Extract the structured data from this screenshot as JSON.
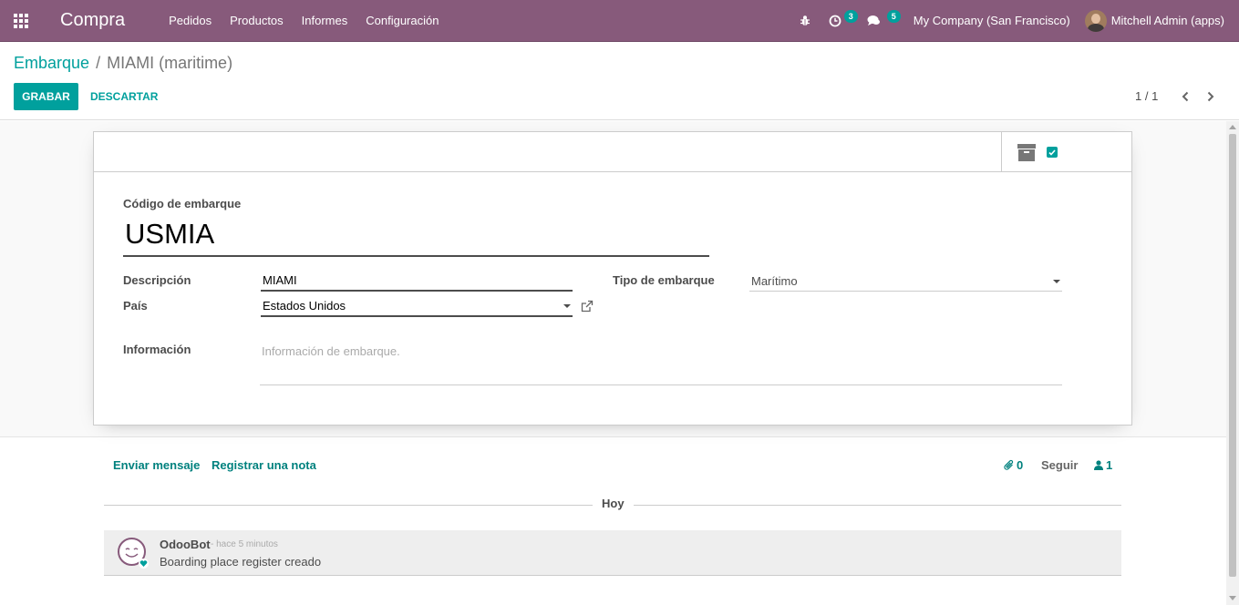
{
  "navbar": {
    "app_name": "Compra",
    "menu": [
      "Pedidos",
      "Productos",
      "Informes",
      "Configuración"
    ],
    "activity_count": "3",
    "message_count": "5",
    "company": "My Company (San Francisco)",
    "user": "Mitchell Admin (apps)",
    "bg_color": "#875a7b"
  },
  "breadcrumb": {
    "parent": "Embarque",
    "separator": "/",
    "current": "MIAMI (maritime)"
  },
  "actions": {
    "save_label": "GRABAR",
    "discard_label": "DESCARTAR"
  },
  "pager": {
    "value": "1 / 1"
  },
  "form": {
    "code_label": "Código de embarque",
    "code_value": "USMIA",
    "description_label": "Descripción",
    "description_value": "MIAMI",
    "country_label": "País",
    "country_value": "Estados Unidos",
    "shipment_type_label": "Tipo de embarque",
    "shipment_type_value": "Marítimo",
    "info_label": "Información",
    "info_placeholder": "Información de embarque.",
    "active": true
  },
  "chatter": {
    "send_message": "Enviar mensaje",
    "log_note": "Registrar una nota",
    "attachments_count": "0",
    "follow_label": "Seguir",
    "followers_count": "1",
    "date_separator": "Hoy",
    "messages": [
      {
        "author": "OdooBot",
        "time": "- hace 5 minutos",
        "body": "Boarding place register creado"
      }
    ]
  },
  "colors": {
    "accent": "#00a09d",
    "brand": "#875a7b"
  }
}
